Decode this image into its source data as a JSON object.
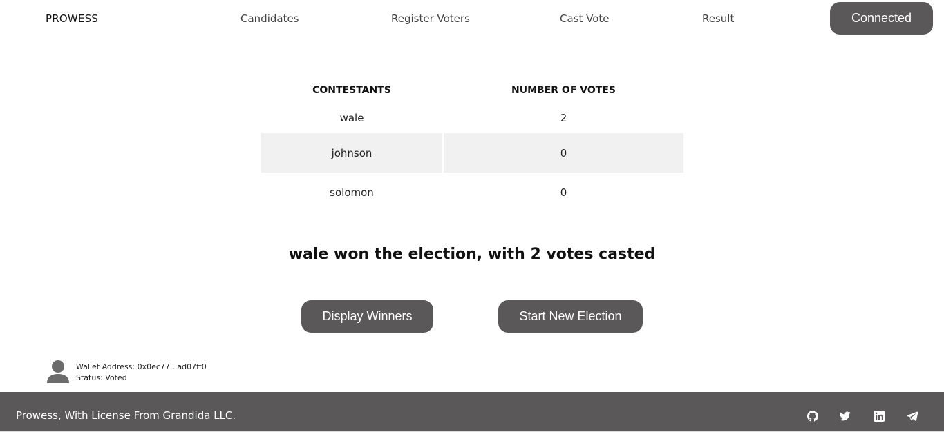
{
  "nav": {
    "brand": "PROWESS",
    "links": [
      "Candidates",
      "Register Voters",
      "Cast Vote",
      "Result"
    ],
    "connect_label": "Connected"
  },
  "results": {
    "headers": [
      "CONTESTANTS",
      "NUMBER OF VOTES"
    ],
    "rows": [
      {
        "name": "wale",
        "votes": "2"
      },
      {
        "name": "johnson",
        "votes": "0"
      },
      {
        "name": "solomon",
        "votes": "0"
      }
    ]
  },
  "winner_text": "wale won the election, with 2 votes casted",
  "actions": {
    "display_winners": "Display Winners",
    "start_new_election": "Start New Election"
  },
  "wallet": {
    "address": "Wallet Address: 0x0ec77...ad07ff0",
    "status": "Status: Voted"
  },
  "footer": {
    "text": "Prowess, With License From Grandida LLC.",
    "social_icons": [
      "github-icon",
      "twitter-icon",
      "linkedin-icon",
      "telegram-icon"
    ]
  },
  "colors": {
    "button_bg": "#5a5859",
    "footer_bg": "#5a5859",
    "row_alt_bg": "#f1f1f1"
  }
}
